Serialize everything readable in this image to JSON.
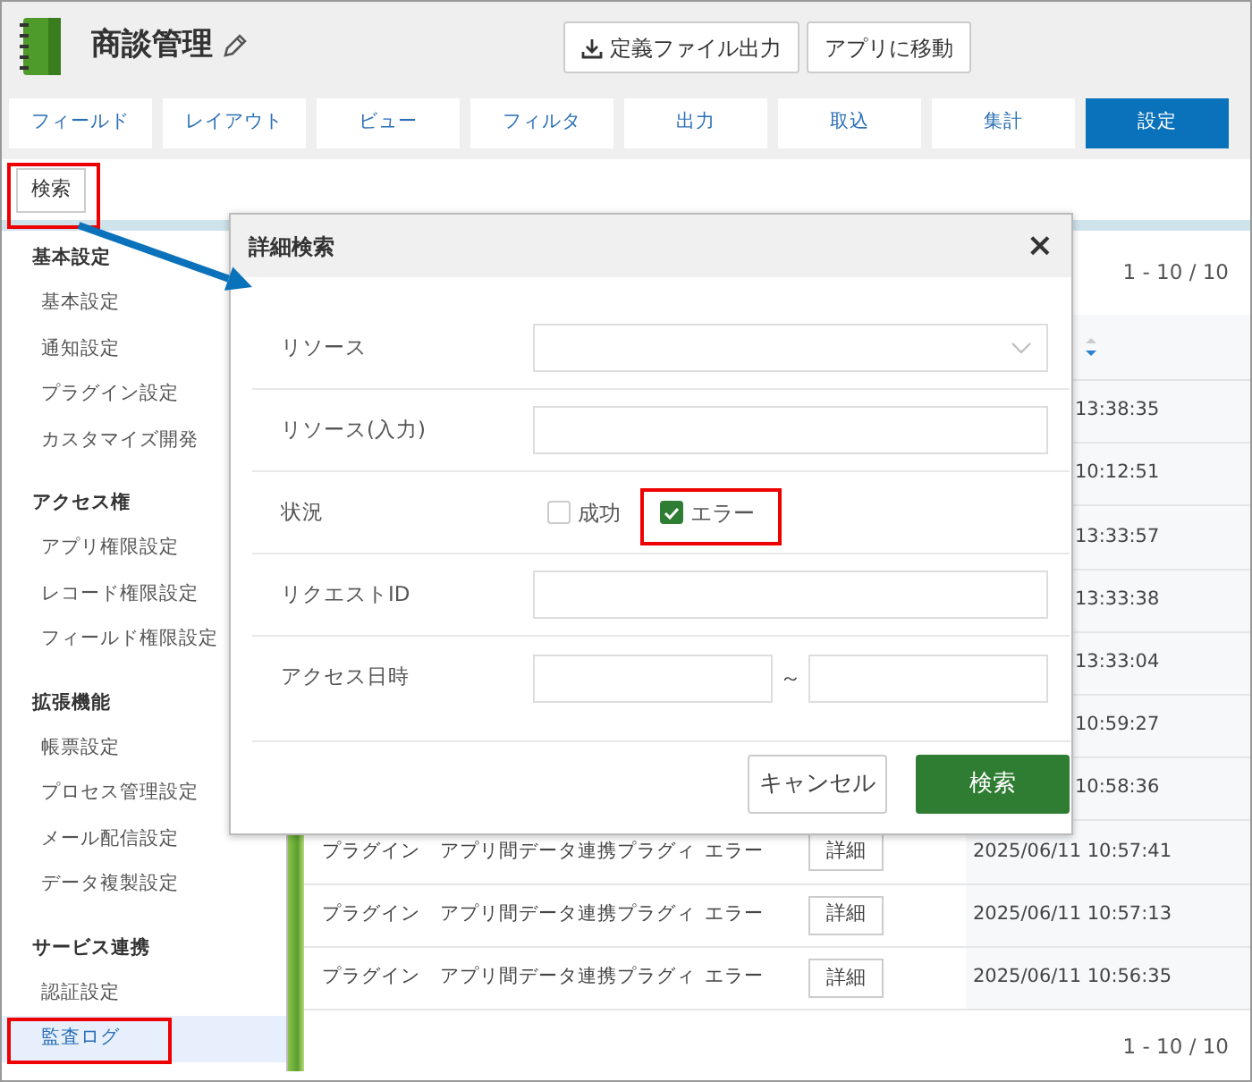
{
  "header": {
    "title": "商談管理",
    "buttons": [
      {
        "label": "定義ファイル出力",
        "kind": "download"
      },
      {
        "label": "アプリに移動",
        "kind": "plain"
      }
    ]
  },
  "tabs": [
    {
      "label": "フィールド",
      "selected": false
    },
    {
      "label": "レイアウト",
      "selected": false
    },
    {
      "label": "ビュー",
      "selected": false
    },
    {
      "label": "フィルタ",
      "selected": false
    },
    {
      "label": "出力",
      "selected": false
    },
    {
      "label": "取込",
      "selected": false
    },
    {
      "label": "集計",
      "selected": false
    },
    {
      "label": "設定",
      "selected": true
    }
  ],
  "search_button": {
    "label": "検索",
    "highlighted": true
  },
  "sidebar": {
    "groups": [
      {
        "title": "基本設定",
        "items": [
          {
            "label": "基本設定",
            "selected": false,
            "highlighted": false
          },
          {
            "label": "通知設定",
            "selected": false,
            "highlighted": false
          },
          {
            "label": "プラグイン設定",
            "selected": false,
            "highlighted": false
          },
          {
            "label": "カスタマイズ開発",
            "selected": false,
            "highlighted": false
          }
        ]
      },
      {
        "title": "アクセス権",
        "items": [
          {
            "label": "アプリ権限設定",
            "selected": false,
            "highlighted": false
          },
          {
            "label": "レコード権限設定",
            "selected": false,
            "highlighted": false
          },
          {
            "label": "フィールド権限設定",
            "selected": false,
            "highlighted": false
          }
        ]
      },
      {
        "title": "拡張機能",
        "items": [
          {
            "label": "帳票設定",
            "selected": false,
            "highlighted": false
          },
          {
            "label": "プロセス管理設定",
            "selected": false,
            "highlighted": false
          },
          {
            "label": "メール配信設定",
            "selected": false,
            "highlighted": false
          },
          {
            "label": "データ複製設定",
            "selected": false,
            "highlighted": false
          }
        ]
      },
      {
        "title": "サービス連携",
        "items": [
          {
            "label": "認証設定",
            "selected": false,
            "highlighted": false
          },
          {
            "label": "監査ログ",
            "selected": true,
            "highlighted": true
          }
        ]
      }
    ]
  },
  "pager_top": "1 - 10 / 10",
  "table": {
    "rows": [
      {
        "kind": "covered",
        "datetime": "13:38:35"
      },
      {
        "kind": "covered",
        "datetime": "10:12:51"
      },
      {
        "kind": "covered",
        "datetime": "13:33:57"
      },
      {
        "kind": "covered",
        "datetime": "13:33:38"
      },
      {
        "kind": "covered",
        "datetime": "13:33:04"
      },
      {
        "kind": "covered",
        "datetime": "10:59:27"
      },
      {
        "kind": "covered",
        "datetime": "10:58:36"
      },
      {
        "kind": "full",
        "type": "プラグイン",
        "resource": "アプリ間データ連携プラグィ",
        "status": "エラー",
        "action": "詳細",
        "datetime": "2025/06/11 10:57:41"
      },
      {
        "kind": "full",
        "type": "プラグイン",
        "resource": "アプリ間データ連携プラグィ",
        "status": "エラー",
        "action": "詳細",
        "datetime": "2025/06/11 10:57:13"
      },
      {
        "kind": "full",
        "type": "プラグイン",
        "resource": "アプリ間データ連携プラグィ",
        "status": "エラー",
        "action": "詳細",
        "datetime": "2025/06/11 10:56:35"
      }
    ]
  },
  "pager_bottom": "1 - 10 / 10",
  "dialog": {
    "title": "詳細検索",
    "close": "×",
    "fields": [
      {
        "label": "リソース",
        "kind": "select"
      },
      {
        "label": "リソース(入力)",
        "kind": "text"
      },
      {
        "label": "状況",
        "kind": "checks",
        "options": [
          {
            "label": "成功",
            "checked": false,
            "highlighted": false
          },
          {
            "label": "エラー",
            "checked": true,
            "highlighted": true
          }
        ]
      },
      {
        "label": "リクエストID",
        "kind": "text"
      },
      {
        "label": "アクセス日時",
        "kind": "range",
        "separator": "～"
      }
    ],
    "buttons": [
      {
        "label": "キャンセル",
        "kind": "secondary"
      },
      {
        "label": "検索",
        "kind": "primary"
      }
    ]
  }
}
